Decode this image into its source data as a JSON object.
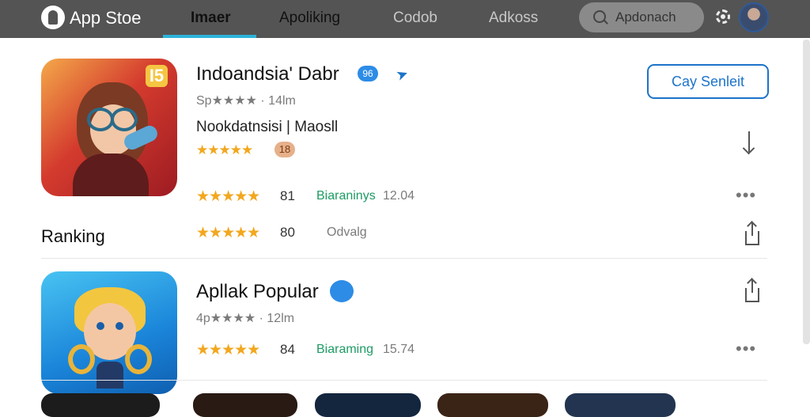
{
  "header": {
    "brand": "App Stoe",
    "tabs": [
      "Imaer",
      "Apoliking",
      "Codob",
      "Adkoss"
    ],
    "active_tab_index": 0,
    "search_placeholder": "Apdonach"
  },
  "colors": {
    "topbar": "#545454",
    "accent": "#2bb3d9",
    "link": "#1d74c9",
    "star": "#f2a71e",
    "green": "#1d9b64"
  },
  "apps": [
    {
      "name": "Indoandsia' Dabr",
      "badge": "96",
      "meta": "Sp★★★★ · 14lm",
      "subtitle": "Nookdatnsisi | Maosll",
      "rating_stars": "★★★★★",
      "rating_badge": "18",
      "cta": "Cay Senleit",
      "row1": {
        "stars": "★★★★★",
        "score": "81",
        "label": "Biaraninys",
        "value": "12.04"
      },
      "row2": {
        "stars": "★★★★★",
        "score": "80",
        "label": "Odvalg"
      }
    },
    {
      "name": "Apllak Popular",
      "meta": "4p★★★★ · 12lm",
      "row1": {
        "stars": "★★★★★",
        "score": "84",
        "label": "Biaraming",
        "value": "15.74"
      }
    }
  ],
  "section_title": "Ranking",
  "icons": [
    "app-store-logo-icon",
    "search-icon",
    "gear-icon",
    "verified-icon",
    "cursor-icon",
    "download-icon",
    "more-icon",
    "share-icon"
  ]
}
